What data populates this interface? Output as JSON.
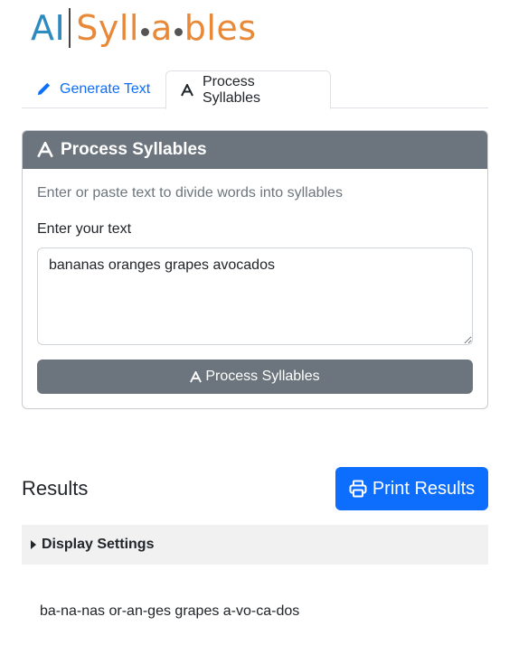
{
  "logo": {
    "part_a": "AI",
    "syl_1": "Syll",
    "syl_2": "a",
    "syl_3": "bles"
  },
  "tabs": [
    {
      "label": "Generate Text",
      "icon": "pencil-icon",
      "active": false
    },
    {
      "label": "Process Syllables",
      "icon": "font-a-icon",
      "active": true
    }
  ],
  "card": {
    "header": "Process Syllables",
    "description": "Enter or paste text to divide words into syllables",
    "input_label": "Enter your text",
    "input_value": "bananas oranges grapes avocados",
    "button_label": "Process Syllables"
  },
  "results": {
    "title": "Results",
    "print_label": "Print Results",
    "settings_label": "Display Settings",
    "output": "ba-na-nas or-an-ges grapes a-vo-ca-dos"
  },
  "colors": {
    "primary": "#0d6efd",
    "secondary": "#6c757d",
    "logo_blue": "#2d8bbf",
    "logo_orange": "#e8893a"
  }
}
